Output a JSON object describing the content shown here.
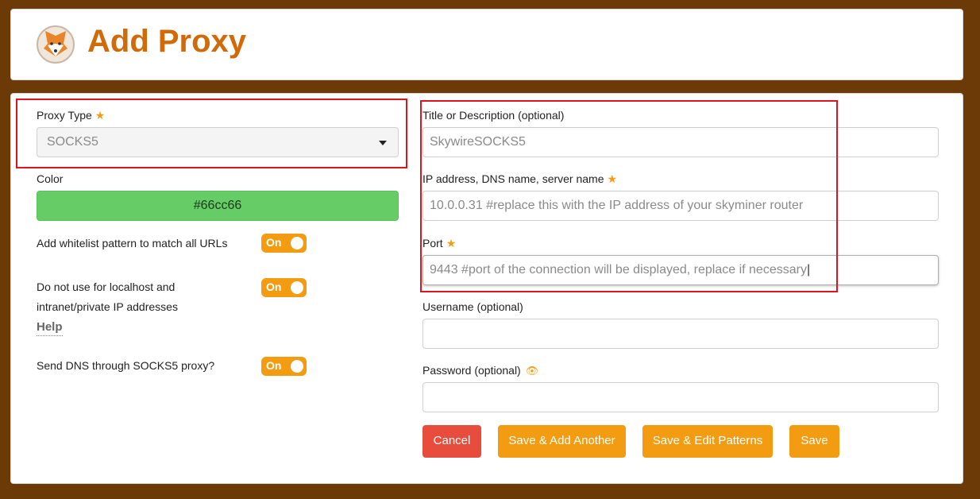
{
  "header": {
    "title": "Add Proxy",
    "logo_icon": "fox-logo"
  },
  "left": {
    "proxy_type_label": "Proxy Type",
    "proxy_type_value": "SOCKS5",
    "color_label": "Color",
    "color_value": "#66cc66",
    "whitelist_label": "Add whitelist pattern to match all URLs",
    "whitelist_toggle": "On",
    "localhost_label_line1": "Do not use for localhost and",
    "localhost_label_line2": "intranet/private IP addresses",
    "localhost_toggle": "On",
    "help_link": "Help",
    "dns_label": "Send DNS through SOCKS5 proxy?",
    "dns_toggle": "On"
  },
  "right": {
    "title_label": "Title or Description (optional)",
    "title_value": "SkywireSOCKS5",
    "address_label": "IP address, DNS name, server name",
    "address_value": "10.0.0.31 #replace this with the IP address of your skyminer router",
    "port_label": "Port",
    "port_value": "9443 #port of the connection will be displayed, replace if necessary",
    "username_label": "Username (optional)",
    "username_value": "",
    "password_label": "Password (optional)",
    "password_value": ""
  },
  "buttons": {
    "cancel": "Cancel",
    "save_add_another": "Save & Add Another",
    "save_edit_patterns": "Save & Edit Patterns",
    "save": "Save"
  },
  "colors": {
    "background": "#6b3a06",
    "title": "#d16a08",
    "accent": "#f39c12",
    "cancel": "#e74c3c",
    "proxy_color": "#66cc66",
    "highlight": "#e0141e"
  }
}
